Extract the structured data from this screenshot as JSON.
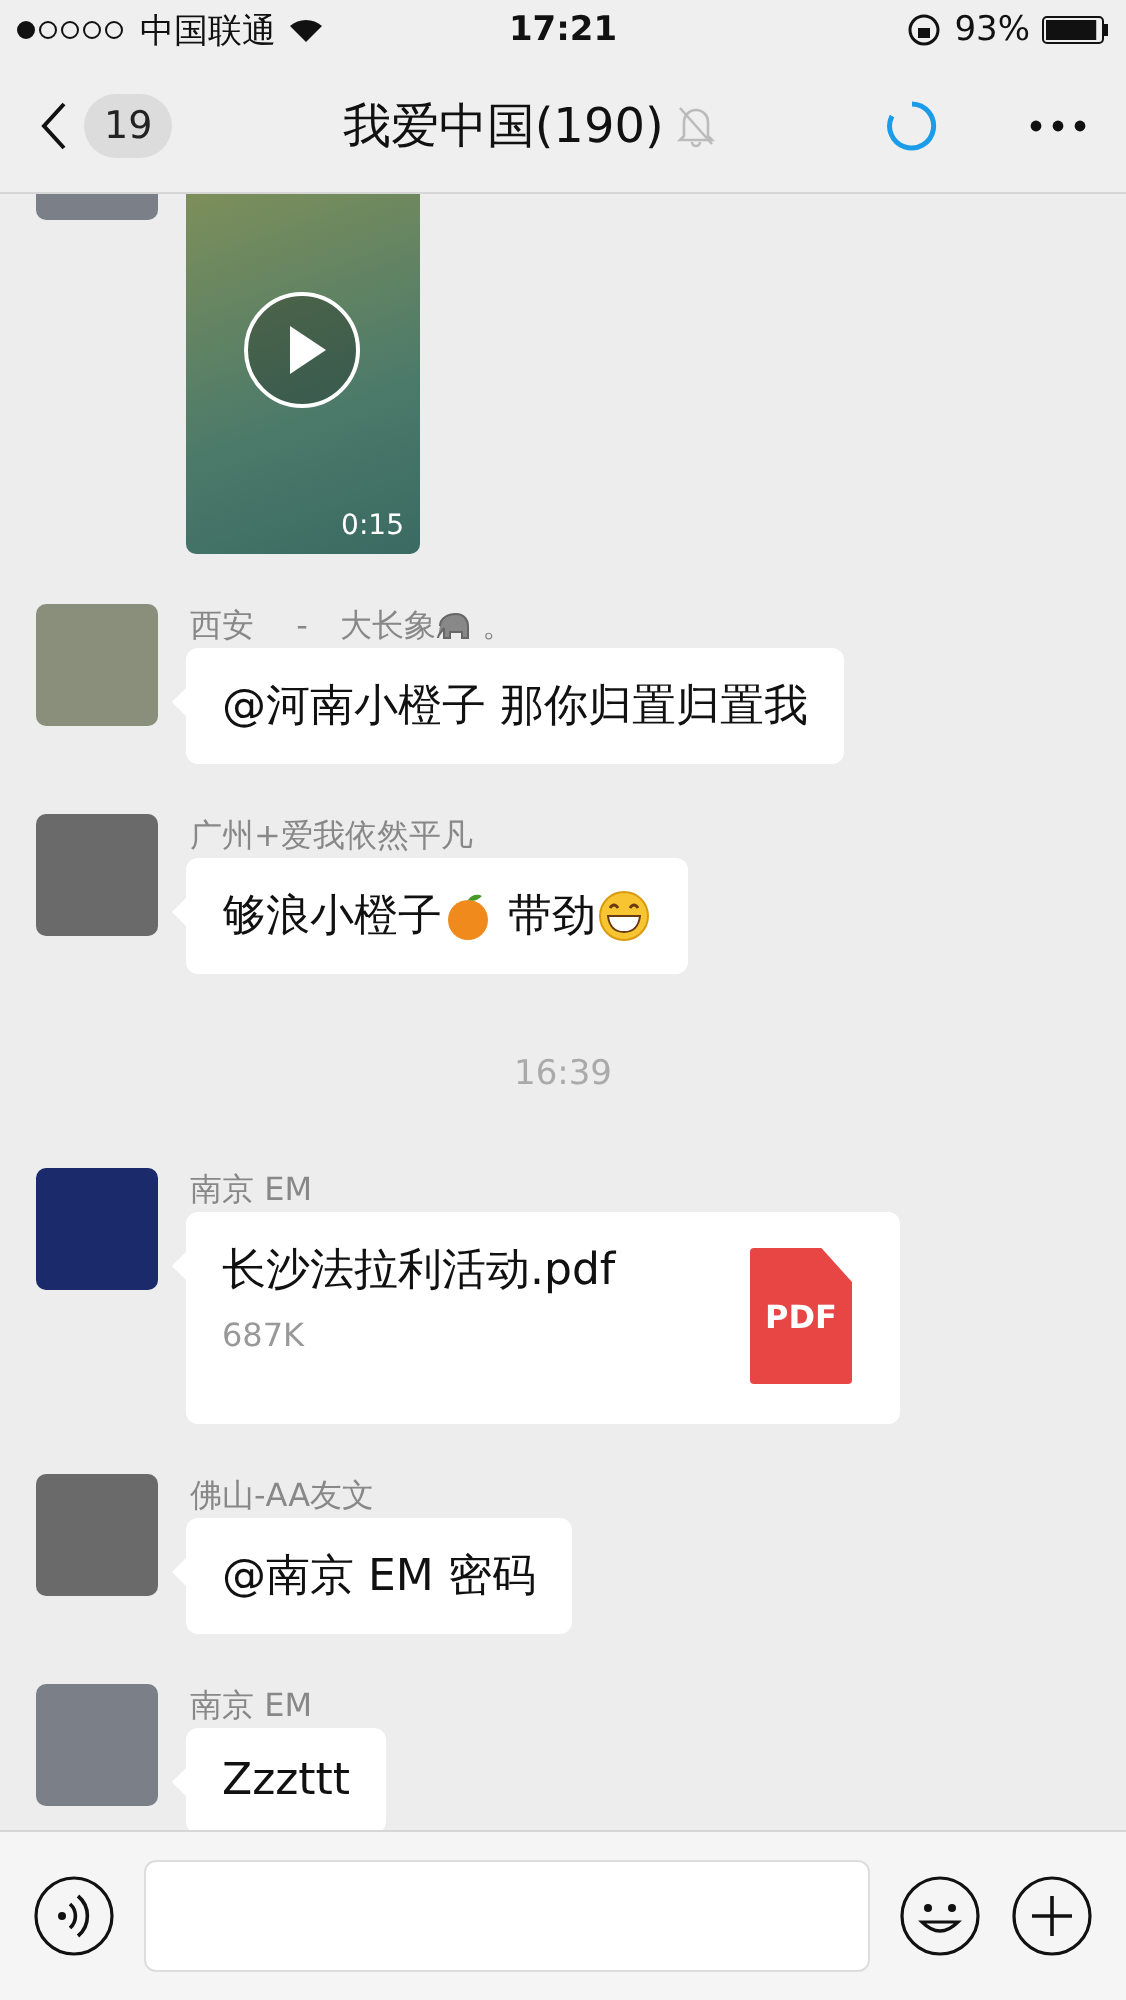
{
  "status_bar": {
    "carrier": "中国联通",
    "time": "17:21",
    "battery": "93%"
  },
  "nav": {
    "badge": "19",
    "title": "我爱中国(190)",
    "muted": true,
    "loading": true
  },
  "messages": [
    {
      "kind": "video",
      "duration": "0:15"
    },
    {
      "kind": "text",
      "sender": [
        {
          "kind": "text",
          "text": "西安　 -　大长象"
        },
        {
          "kind": "emoji"
        },
        {
          "kind": "text",
          "text": " 。"
        }
      ],
      "body": [
        {
          "kind": "text",
          "text": "@河南小橙子 那你归置归置我"
        }
      ]
    },
    {
      "kind": "text",
      "sender": [
        {
          "kind": "text",
          "text": "广州+爱我依然平凡"
        }
      ],
      "body": [
        {
          "kind": "text",
          "text": "够浪小橙子"
        },
        {
          "kind": "emoji"
        },
        {
          "kind": "text",
          "text": " 带劲"
        },
        {
          "kind": "emoji"
        }
      ]
    },
    {
      "kind": "time",
      "text": "16:39"
    },
    {
      "kind": "file",
      "sender": [
        {
          "kind": "text",
          "text": "南京 EM"
        }
      ],
      "file_name": "长沙法拉利活动.pdf",
      "size": "687K",
      "file_type": "PDF"
    },
    {
      "kind": "text",
      "sender": [
        {
          "kind": "text",
          "text": "佛山-AA友文"
        }
      ],
      "body": [
        {
          "kind": "text",
          "text": "@南京 EM 密码"
        }
      ]
    },
    {
      "kind": "text",
      "sender": [
        {
          "kind": "text",
          "text": "南京 EM"
        }
      ],
      "body": [
        {
          "kind": "text",
          "text": "Zzzttt"
        }
      ]
    }
  ]
}
